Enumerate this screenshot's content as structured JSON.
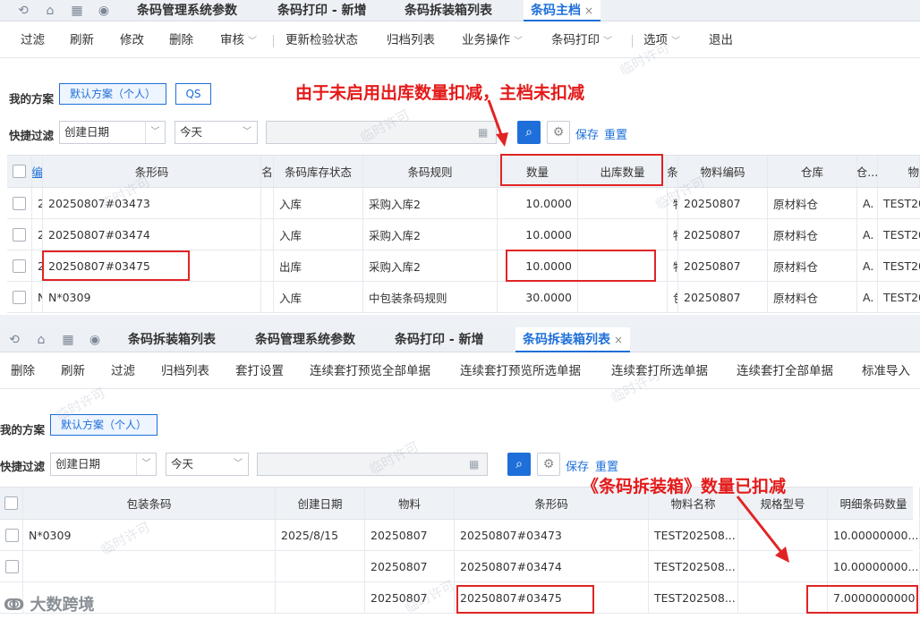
{
  "top": {
    "tabs": [
      {
        "label": "条码管理系统参数"
      },
      {
        "label": "条码打印 - 新增"
      },
      {
        "label": "条码拆装箱列表"
      },
      {
        "label": "条码主档",
        "close": "×"
      }
    ],
    "toolbar": [
      "过滤",
      "刷新",
      "修改",
      "删除",
      "审核",
      "更新检验状态",
      "归档列表",
      "业务操作",
      "条码打印",
      "选项",
      "退出"
    ],
    "scheme_label": "我的方案",
    "scheme_btn": "默认方案（个人）",
    "qs_btn": "QS",
    "quick_filter_label": "快捷过滤",
    "filter_field": "创建日期",
    "filter_op": "今天",
    "save": "保存",
    "reset": "重置",
    "annotation": "由于未启用出库数量扣减，主档未扣减",
    "columns": [
      "编",
      "条形码",
      "名",
      "条码库存状态",
      "条码规则",
      "数量",
      "出库数量",
      "条",
      "物料编码",
      "仓库",
      "仓...",
      "物"
    ],
    "rows": [
      {
        "idx": "2",
        "barcode": "20250807#03473",
        "status": "入库",
        "rule": "采购入库2",
        "qty": "10.0000",
        "out": "",
        "c": "物",
        "mat": "20250807",
        "wh": "原材料仓",
        "w2": "A.",
        "name": "TEST20"
      },
      {
        "idx": "2",
        "barcode": "20250807#03474",
        "status": "入库",
        "rule": "采购入库2",
        "qty": "10.0000",
        "out": "",
        "c": "物",
        "mat": "20250807",
        "wh": "原材料仓",
        "w2": "A.",
        "name": "TEST20"
      },
      {
        "idx": "2",
        "barcode": "20250807#03475",
        "status": "出库",
        "rule": "采购入库2",
        "qty": "10.0000",
        "out": "",
        "c": "物",
        "mat": "20250807",
        "wh": "原材料仓",
        "w2": "A.",
        "name": "TEST20"
      },
      {
        "idx": "N",
        "barcode": "N*0309",
        "status": "入库",
        "rule": "中包装条码规则",
        "qty": "30.0000",
        "out": "",
        "c": "包",
        "mat": "20250807",
        "wh": "原材料仓",
        "w2": "A.",
        "name": "TEST20"
      }
    ]
  },
  "bottom": {
    "tabs": [
      {
        "label": "条码拆装箱列表"
      },
      {
        "label": "条码管理系统参数"
      },
      {
        "label": "条码打印 - 新增"
      },
      {
        "label": "条码拆装箱列表",
        "close": "×"
      }
    ],
    "toolbar": [
      "删除",
      "刷新",
      "过滤",
      "归档列表",
      "套打设置",
      "连续套打预览全部单据",
      "连续套打预览所选单据",
      "连续套打所选单据",
      "连续套打全部单据",
      "标准导入"
    ],
    "scheme_label": "我的方案",
    "scheme_btn": "默认方案（个人）",
    "quick_filter_label": "快捷过滤",
    "filter_field": "创建日期",
    "filter_op": "今天",
    "save": "保存",
    "reset": "重置",
    "annotation": "《条码拆装箱》数量已扣减",
    "columns": [
      "包装条码",
      "创建日期",
      "物料",
      "条形码",
      "物料名称",
      "规格型号",
      "明细条码数量"
    ],
    "rows": [
      {
        "pack": "N*0309",
        "date": "2025/8/15",
        "mat": "20250807",
        "barcode": "20250807#03473",
        "name": "TEST202508...",
        "spec": "",
        "qty": "10.00000000..."
      },
      {
        "pack": "",
        "date": "",
        "mat": "20250807",
        "barcode": "20250807#03474",
        "name": "TEST202508...",
        "spec": "",
        "qty": "10.00000000..."
      },
      {
        "pack": "",
        "date": "",
        "mat": "20250807",
        "barcode": "20250807#03475",
        "name": "TEST202508...",
        "spec": "",
        "qty": "7.0000000000"
      }
    ]
  },
  "watermark": "临时许可",
  "logo": "大数跨境",
  "colors": {
    "accent": "#1e6fd9",
    "annotation_red": "#e02424"
  }
}
